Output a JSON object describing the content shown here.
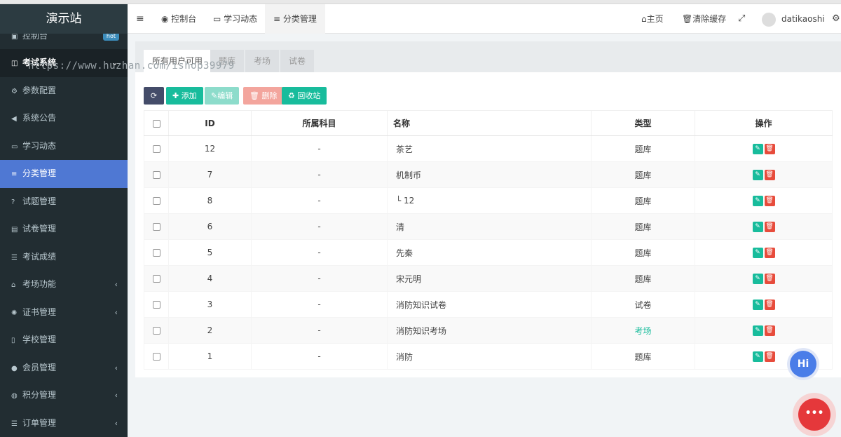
{
  "sidebar": {
    "logo": "演示站",
    "partial_item": "控制台",
    "partial_badge": "hot",
    "section": "考试系统",
    "items": [
      {
        "label": "参数配置",
        "icon": "⚙"
      },
      {
        "label": "系统公告",
        "icon": "◀"
      },
      {
        "label": "学习动态",
        "icon": "▭"
      },
      {
        "label": "分类管理",
        "icon": "≡"
      },
      {
        "label": "试题管理",
        "icon": "?"
      },
      {
        "label": "试卷管理",
        "icon": "▤"
      },
      {
        "label": "考试成绩",
        "icon": "☰"
      },
      {
        "label": "考场功能",
        "icon": "⌂"
      },
      {
        "label": "证书管理",
        "icon": "✺"
      },
      {
        "label": "学校管理",
        "icon": "▯"
      },
      {
        "label": "会员管理",
        "icon": "●"
      },
      {
        "label": "积分管理",
        "icon": "◍"
      },
      {
        "label": "订单管理",
        "icon": "☰"
      }
    ]
  },
  "watermark": "https://www.huzhan.com/ishop39979",
  "topbar": {
    "tabs": [
      "控制台",
      "学习动态",
      "分类管理"
    ],
    "home": "主页",
    "clear_cache": "清除缓存",
    "username": "datikaoshi"
  },
  "content_tabs": [
    "所有用户可用",
    "题库",
    "考场",
    "试卷"
  ],
  "toolbar": {
    "add": "添加",
    "edit": "编辑",
    "delete": "删除",
    "recycle": "回收站"
  },
  "table": {
    "headers": [
      "ID",
      "所属科目",
      "名称",
      "类型",
      "操作"
    ],
    "rows": [
      {
        "id": "12",
        "subject": "-",
        "name": "茶艺",
        "type": "题库"
      },
      {
        "id": "7",
        "subject": "-",
        "name": "机制币",
        "type": "题库"
      },
      {
        "id": "8",
        "subject": "-",
        "name": "└ 12",
        "type": "题库"
      },
      {
        "id": "6",
        "subject": "-",
        "name": "清",
        "type": "题库"
      },
      {
        "id": "5",
        "subject": "-",
        "name": "先秦",
        "type": "题库"
      },
      {
        "id": "4",
        "subject": "-",
        "name": "宋元明",
        "type": "题库"
      },
      {
        "id": "3",
        "subject": "-",
        "name": "消防知识试卷",
        "type": "试卷"
      },
      {
        "id": "2",
        "subject": "-",
        "name": "消防知识考场",
        "type": "考场"
      },
      {
        "id": "1",
        "subject": "-",
        "name": "消防",
        "type": "题库"
      }
    ]
  },
  "floating": {
    "hi": "Hi"
  },
  "colors": {
    "sidebar": "#222d32",
    "active": "#4f78d3",
    "green": "#18bc9c",
    "red": "#e74c3c",
    "exam_type": "#18bc9c"
  }
}
